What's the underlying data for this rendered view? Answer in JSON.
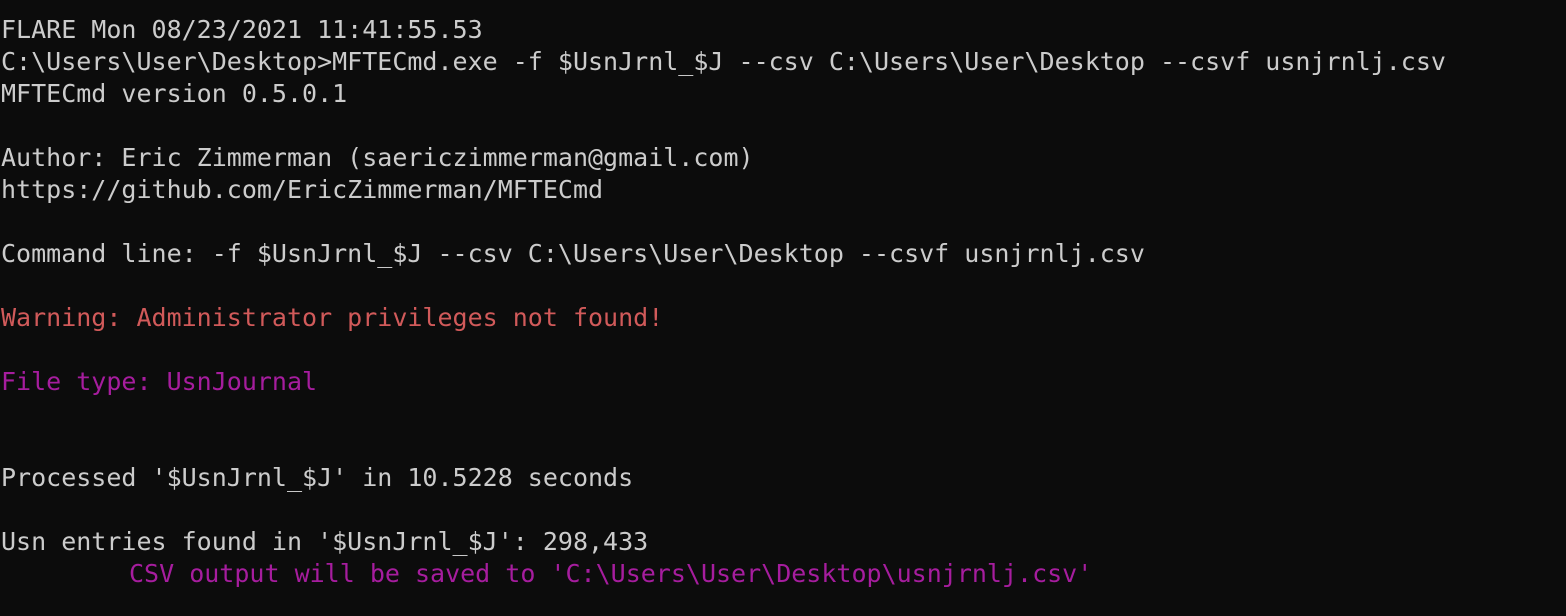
{
  "console": {
    "colors": {
      "background": "#0c0c0c",
      "text": "#cccccc",
      "warning": "#d15a5a",
      "magenta": "#a61d9e"
    },
    "lines": {
      "header": "FLARE Mon 08/23/2021 11:41:55.53",
      "prompt_command": "C:\\Users\\User\\Desktop>MFTECmd.exe -f $UsnJrnl_$J --csv C:\\Users\\User\\Desktop --csvf usnjrnlj.csv",
      "version": "MFTECmd version 0.5.0.1",
      "author": "Author: Eric Zimmerman (saericzimmerman@gmail.com)",
      "url": "https://github.com/EricZimmerman/MFTECmd",
      "command_line": "Command line: -f $UsnJrnl_$J --csv C:\\Users\\User\\Desktop --csvf usnjrnlj.csv",
      "warning": "Warning: Administrator privileges not found!",
      "file_type": "File type: UsnJournal",
      "processed": "Processed '$UsnJrnl_$J' in 10.5228 seconds",
      "entries_found": "Usn entries found in '$UsnJrnl_$J': 298,433",
      "csv_output": "CSV output will be saved to 'C:\\Users\\User\\Desktop\\usnjrnlj.csv'"
    }
  }
}
